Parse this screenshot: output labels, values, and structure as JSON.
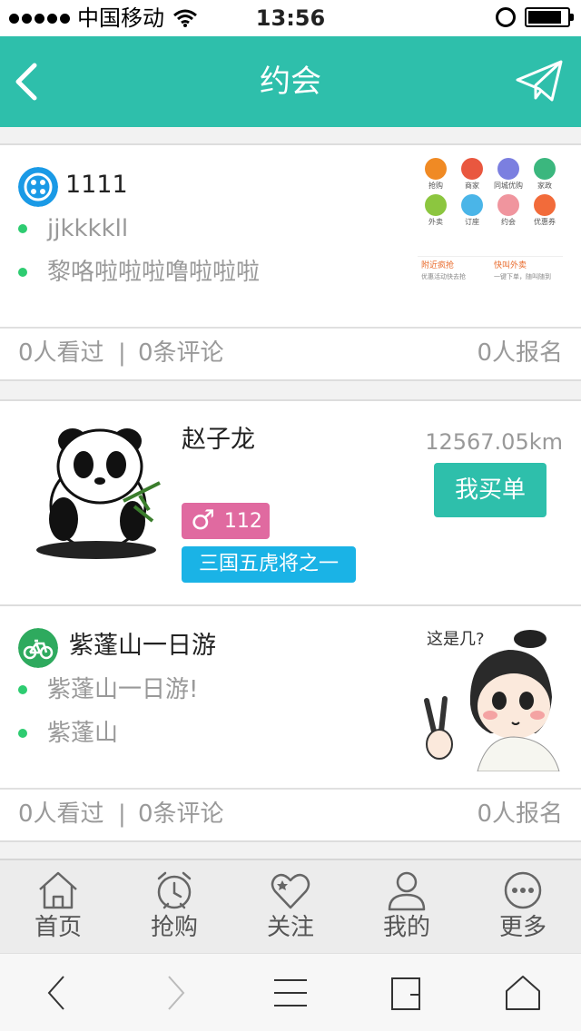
{
  "status_bar": {
    "carrier": "中国移动",
    "time": "13:56"
  },
  "header": {
    "title": "约会"
  },
  "cards": [
    {
      "title": "1111",
      "lines": [
        "jjkkkkll",
        "黎咯啦啦啦噜啦啦啦"
      ],
      "views": "0人看过",
      "separator": "|",
      "comments": "0条评论",
      "signups": "0人报名",
      "thumb": {
        "grid": [
          "抢购",
          "商家",
          "同城优购",
          "家政",
          "外卖",
          "订座",
          "约会",
          "优惠券"
        ],
        "promo_left": "附近疯抢",
        "promo_left_sub": "优惠活动快去抢",
        "promo_right": "快叫外卖",
        "promo_right_sub": "一键下单，随叫随到"
      }
    },
    {
      "title": "紫蓬山一日游",
      "lines": [
        "紫蓬山一日游!",
        "紫蓬山"
      ],
      "views": "0人看过",
      "separator": "|",
      "comments": "0条评论",
      "signups": "0人报名",
      "cartoon_text": "这是几?"
    }
  ],
  "user": {
    "name": "赵子龙",
    "distance": "12567.05km",
    "buy_label": "我买单",
    "gender_symbol": "♂",
    "age": "112",
    "tag": "三国五虎将之一"
  },
  "tabs": [
    {
      "label": "首页",
      "icon": "home-icon"
    },
    {
      "label": "抢购",
      "icon": "alarm-clock-icon"
    },
    {
      "label": "关注",
      "icon": "heart-icon"
    },
    {
      "label": "我的",
      "icon": "user-icon"
    },
    {
      "label": "更多",
      "icon": "more-icon"
    }
  ],
  "colors": {
    "accent": "#2ebfab",
    "gender": "#e06aa0",
    "tag": "#1ab3e6",
    "bullet": "#2ecc71"
  }
}
